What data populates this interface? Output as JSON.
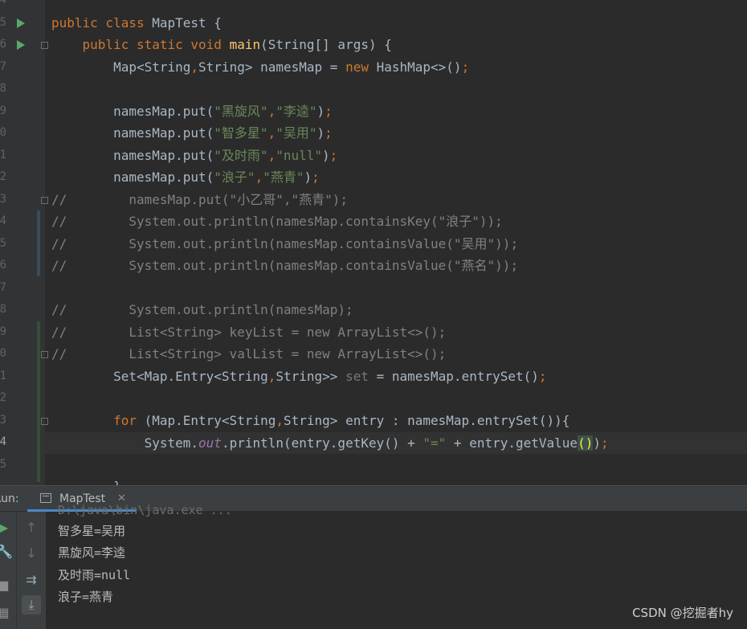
{
  "editor": {
    "line_numbers": [
      "4",
      "5",
      "6",
      "7",
      "8",
      "9",
      "0",
      "1",
      "2",
      "3",
      "4",
      "5",
      "6",
      "7",
      "8",
      "9",
      "0",
      "1",
      "2",
      "3",
      "4",
      "5"
    ],
    "code_lines": [
      "",
      "public class MapTest {",
      "    public static void main(String[] args) {",
      "        Map<String,String> namesMap = new HashMap<>();",
      "",
      "        namesMap.put(\"黑旋风\",\"李逵\");",
      "        namesMap.put(\"智多星\",\"吴用\");",
      "        namesMap.put(\"及时雨\",\"null\");",
      "        namesMap.put(\"浪子\",\"燕青\");",
      "//        namesMap.put(\"小乙哥\",\"燕青\");",
      "//        System.out.println(namesMap.containsKey(\"浪子\"));",
      "//        System.out.println(namesMap.containsValue(\"吴用\"));",
      "//        System.out.println(namesMap.containsValue(\"燕名\"));",
      "",
      "//        System.out.println(namesMap);",
      "//        List<String> keyList = new ArrayList<>();",
      "//        List<String> valList = new ArrayList<>();",
      "        Set<Map.Entry<String,String>> set = namesMap.entrySet();",
      "",
      "        for (Map.Entry<String,String> entry : namesMap.entrySet()){",
      "            System.out.println(entry.getKey() + \"=\" + entry.getValue());",
      ""
    ],
    "colors": {
      "keyword": "#cc7832",
      "string": "#6a8759",
      "method_decl": "#ffc66d",
      "comment": "#808080",
      "static_field": "#9876aa",
      "run_icon": "#59a869"
    }
  },
  "run_panel": {
    "label": "Run:",
    "tab_title": "MapTest",
    "close_glyph": "✕",
    "command_line": "D:\\java\\bin\\java.exe ...",
    "output": [
      "智多星=吴用",
      "黑旋风=李逵",
      "及时雨=null",
      "浪子=燕青"
    ],
    "toolbar_icons": [
      "rerun-icon",
      "wrench-icon",
      "stop-icon",
      "scroll-up-icon",
      "scroll-down-icon",
      "soft-wrap-icon",
      "scroll-to-end-icon"
    ]
  },
  "watermark": "CSDN @挖掘者hy"
}
